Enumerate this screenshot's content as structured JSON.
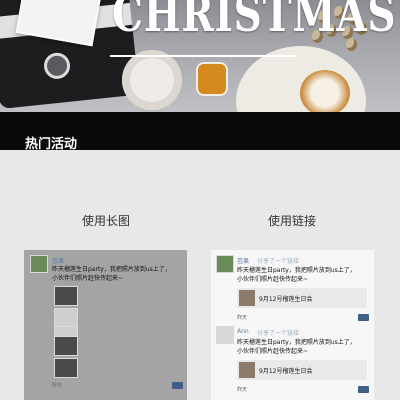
{
  "banner": {
    "title": "CHRISTMAS"
  },
  "section": {
    "title": "热门活动"
  },
  "columns": {
    "left_caption": "使用长图",
    "right_caption": "使用链接"
  },
  "left_card": {
    "user": "芭果",
    "post_line1": "昨天榴莲生日party，我把照片放到us上了，",
    "post_line2": "小伙伴们照片赶快传起来~",
    "time": "昨天"
  },
  "right_card": {
    "posts": [
      {
        "user": "芭果",
        "shared": "分享了一个链接",
        "post_line1": "昨天榴莲生日party，我把照片放到us上了，",
        "post_line2": "小伙伴们照片赶快传起来~",
        "link_title": "9月12号榴莲生日会",
        "time": "昨天"
      },
      {
        "user": "Ann",
        "shared": "分享了一个链接",
        "post_line1": "昨天榴莲生日party，我把照片放到us上了，",
        "post_line2": "小伙伴们照片赶快传起来~",
        "link_title": "9月12号榴莲生日会",
        "time": "昨天"
      }
    ]
  },
  "colors": {
    "section_bar": "#0a0a0a",
    "page_bg": "#e8e8e8",
    "username": "#5d7ea8"
  },
  "icons": [
    "comment-icon",
    "avatar"
  ]
}
